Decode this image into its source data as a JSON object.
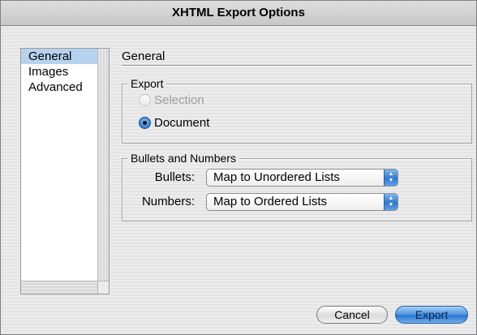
{
  "window": {
    "title": "XHTML Export Options"
  },
  "sidebar": {
    "items": [
      {
        "label": "General",
        "selected": true
      },
      {
        "label": "Images",
        "selected": false
      },
      {
        "label": "Advanced",
        "selected": false
      }
    ]
  },
  "main": {
    "section_title": "General",
    "export_group": {
      "title": "Export",
      "options": [
        {
          "label": "Selection",
          "checked": false,
          "enabled": false
        },
        {
          "label": "Document",
          "checked": true,
          "enabled": true
        }
      ]
    },
    "bullets_group": {
      "title": "Bullets and Numbers",
      "bullets": {
        "label": "Bullets:",
        "value": "Map to Unordered Lists"
      },
      "numbers": {
        "label": "Numbers:",
        "value": "Map to Ordered Lists"
      }
    }
  },
  "buttons": {
    "cancel": "Cancel",
    "export": "Export"
  },
  "colors": {
    "selection_highlight": "#b7d2ef",
    "accent_blue": "#2f78d2"
  },
  "icons": {
    "radio_on": "radio-selected",
    "radio_off": "radio-unselected",
    "popup_arrows": "updown-arrows-icon"
  }
}
